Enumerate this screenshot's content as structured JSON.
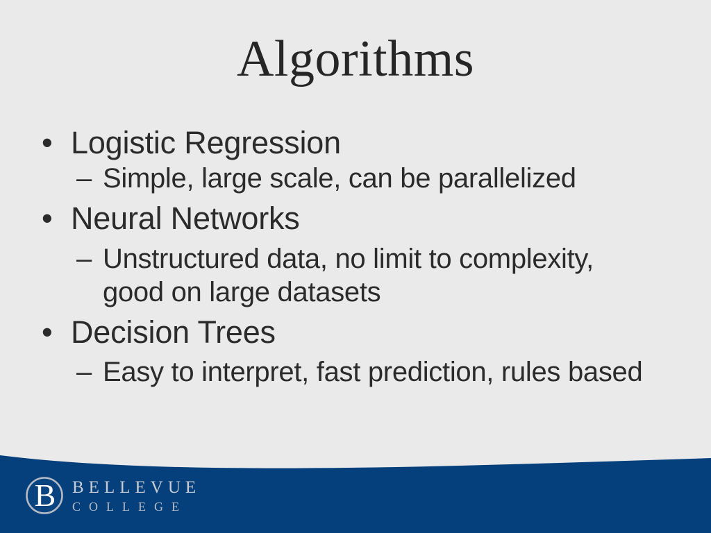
{
  "slide": {
    "title": "Algorithms",
    "background_color": "#EAEAEA",
    "text_color": "#2B2B2B",
    "accent_color": "#05407D"
  },
  "content": {
    "bullet_marker": "•",
    "subbullet_marker": "–",
    "items": [
      {
        "level": 1,
        "text": "Logistic Regression",
        "sub": [
          "Simple, large scale, can be parallelized"
        ]
      },
      {
        "level": 1,
        "text": "Neural Networks",
        "sub": [
          "Unstructured data, no limit to complexity, good on large datasets"
        ]
      },
      {
        "level": 1,
        "text": "Decision Trees",
        "sub": [
          "Easy to interpret, fast prediction, rules based"
        ]
      }
    ],
    "flat_lines": {
      "b1": "Logistic Regression",
      "b1s1": "Simple, large scale, can be parallelized",
      "b2": "Neural Networks",
      "b2s1": "Unstructured data, no limit to complexity, good on large datasets",
      "b3": "Decision Trees",
      "b3s1": "Easy to interpret, fast prediction, rules based"
    }
  },
  "footer": {
    "band_color": "#05407D",
    "logo": {
      "emblem_letter": "B",
      "emblem_ring_color": "#B6BBC4",
      "emblem_fill_color": "#05407D",
      "emblem_letter_color": "#FFFFFF",
      "name_primary": "BELLEVUE",
      "name_secondary": "COLLEGE",
      "name_color": "#C9CCD2"
    }
  }
}
